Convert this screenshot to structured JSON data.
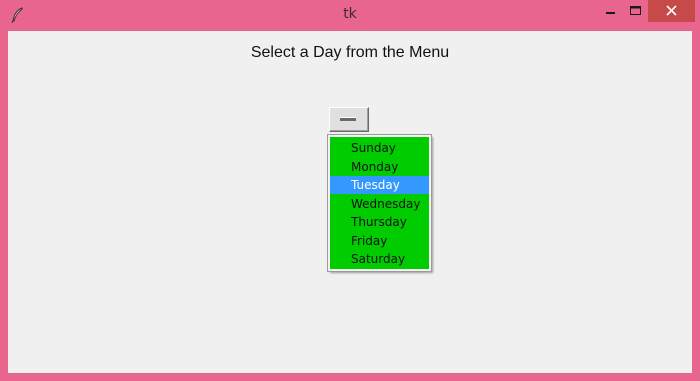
{
  "window": {
    "title": "tk",
    "title_bar_color": "#e8668e",
    "client_background": "#f0f0f0",
    "controls": {
      "minimize_icon": "minimize-icon",
      "maximize_icon": "maximize-icon",
      "close_icon": "close-icon"
    }
  },
  "main": {
    "heading": "Select a Day from the Menu",
    "menubutton": {
      "selected_value": ""
    },
    "menu": {
      "background": "#00cc00",
      "active_background": "#3399ff",
      "active_item": "Tuesday",
      "items": [
        {
          "label": "Sunday"
        },
        {
          "label": "Monday"
        },
        {
          "label": "Tuesday"
        },
        {
          "label": "Wednesday"
        },
        {
          "label": "Thursday"
        },
        {
          "label": "Friday"
        },
        {
          "label": "Saturday"
        }
      ]
    }
  }
}
